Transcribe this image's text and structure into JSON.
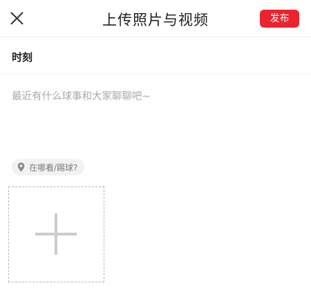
{
  "header": {
    "title": "上传照片与视频",
    "publish_label": "发布",
    "close_icon": "close-icon"
  },
  "section": {
    "label": "时刻"
  },
  "composer": {
    "value": "",
    "placeholder": "最近有什么球事和大家聊聊吧~"
  },
  "location": {
    "icon": "location-pin-icon",
    "label": "在哪看/踢球?"
  },
  "media": {
    "add_icon": "plus-icon"
  },
  "colors": {
    "accent": "#e8252e",
    "placeholder": "#a8a8a8",
    "chip_bg": "#f2f2f2",
    "dashed_border": "#b5b5b5",
    "plus": "#cccccc"
  }
}
